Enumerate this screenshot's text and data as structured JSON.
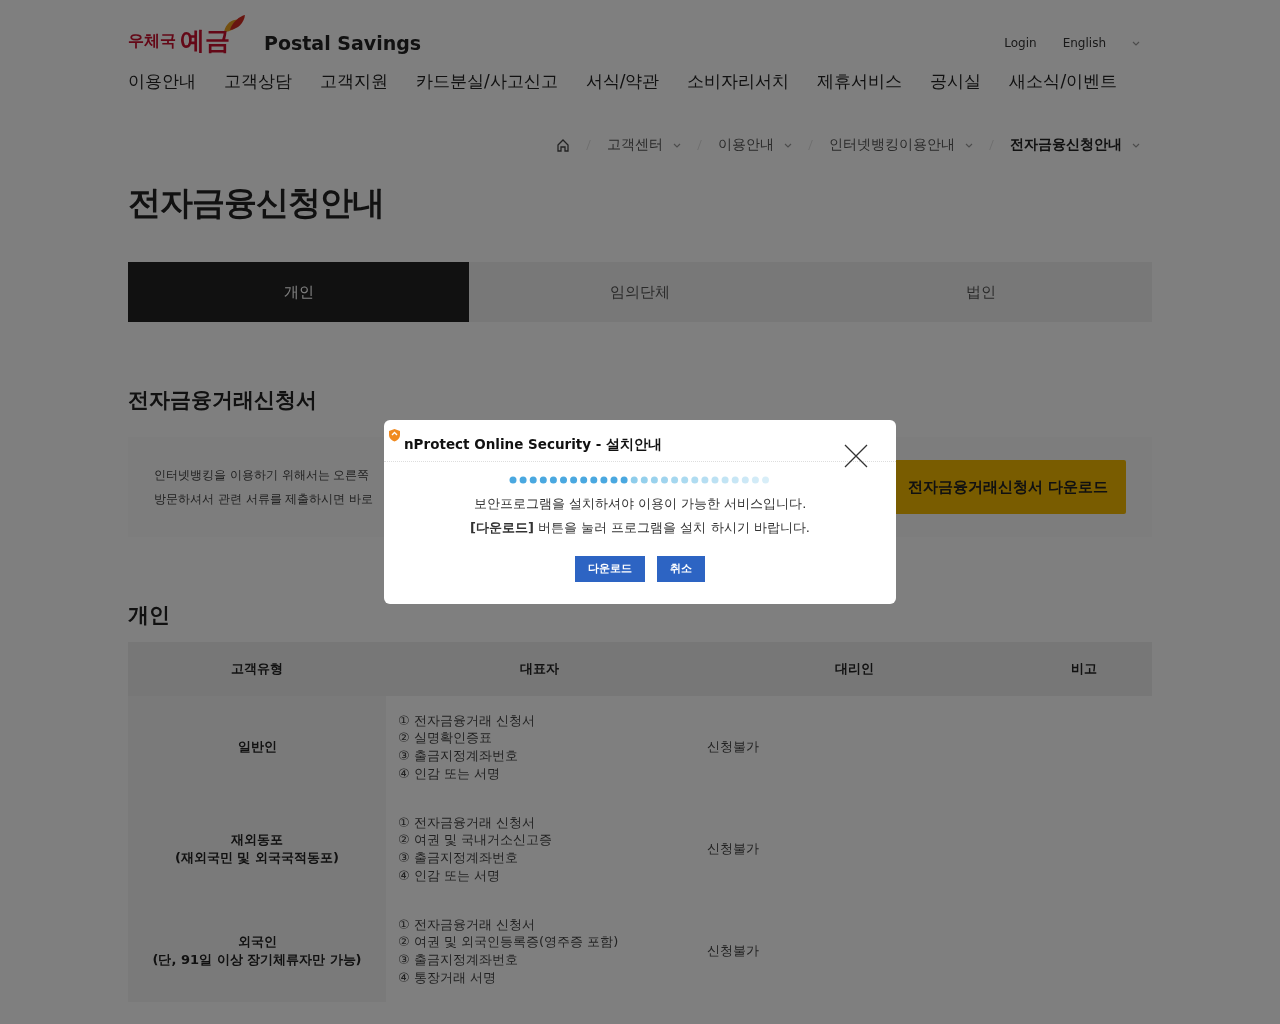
{
  "header": {
    "logo_small": "우체국",
    "logo_large": "예금",
    "logo_english": "Postal Savings",
    "links": [
      "Login",
      "English"
    ],
    "nav": [
      "이용안내",
      "고객상담",
      "고객지원",
      "카드분실/사고신고",
      "서식/약관",
      "소비자리서치",
      "제휴서비스",
      "공시실",
      "새소식/이벤트"
    ]
  },
  "breadcrumb": [
    {
      "label": "고객센터",
      "current": false
    },
    {
      "label": "이용안내",
      "current": false
    },
    {
      "label": "인터넷뱅킹이용안내",
      "current": false
    },
    {
      "label": "전자금융신청안내",
      "current": true
    }
  ],
  "page_title": "전자금융신청안내",
  "tabs": [
    {
      "label": "개인",
      "selected": true
    },
    {
      "label": "임의단체",
      "selected": false
    },
    {
      "label": "법인",
      "selected": false
    }
  ],
  "section_title": "전자금융거래신청서",
  "notice_lines": [
    "인터넷뱅킹을 이용하기 위해서는 오른쪽",
    "방문하셔서 관련 서류를 제출하시면 바로"
  ],
  "download_button": "전자금융거래신청서 다운로드",
  "table_title": "개인",
  "table": {
    "columns": [
      "고객유형",
      "대표자",
      "대리인",
      "비고"
    ],
    "rows": [
      {
        "type": [
          "일반인"
        ],
        "documents": [
          "① 전자금융거래 신청서",
          "② 실명확인증표",
          "③ 출금지정계좌번호",
          "④ 인감 또는 서명"
        ],
        "agent": "신청불가"
      },
      {
        "type": [
          "재외동포",
          "(재외국민 및 외국국적동포)"
        ],
        "documents": [
          "① 전자금융거래 신청서",
          "② 여권 및 국내거소신고증",
          "③ 출금지정계좌번호",
          "④ 인감 또는 서명"
        ],
        "agent": "신청불가"
      },
      {
        "type": [
          "외국인",
          "(단, 91일 이상 장기체류자만 가능)"
        ],
        "documents": [
          "① 전자금융거래 신청서",
          "② 여권 및 외국인등록증(영주증 포함)",
          "③ 출금지정계좌번호",
          "④ 통장거래 서명"
        ],
        "agent": "신청불가"
      }
    ]
  },
  "dialog": {
    "title": "nProtect Online Security - 설치안내",
    "message_lines": [
      "보안프로그램을 설치하셔야 이용이 가능한 서비스입니다.",
      "**[다운로드]** 버튼을 눌러 프로그램을 설치 하시기 바랍니다."
    ],
    "buttons": [
      "다운로드",
      "취소"
    ]
  }
}
